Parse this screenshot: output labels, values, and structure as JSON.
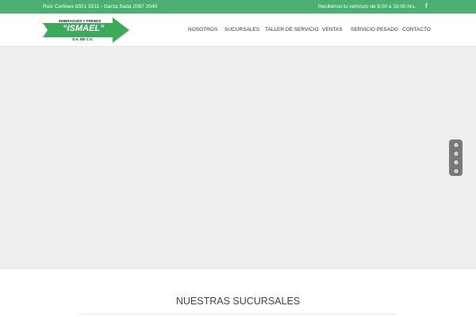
{
  "topbar": {
    "contact_text": "Ruiz Cortines 8351 5511 - Garza Sada 2087 2040",
    "hours_text": "Recibimos tu vehículo de 8:00 a 18:00 hrs.",
    "facebook_glyph": "f"
  },
  "logo": {
    "line1": "EMBRAGUES Y FRENOS",
    "line2": "“ISMAEL”",
    "line3": "S.A. DE C.V.",
    "arrow_color": "#3daa5b"
  },
  "nav": {
    "items": [
      "NOSOTROS",
      "SUCURSALES",
      "TALLER DE SERVICIO",
      "VENTAS",
      "SERVICIO PESADO",
      "CONTACTO"
    ]
  },
  "slider": {
    "dot_count": 4
  },
  "section": {
    "title": "NUESTRAS SUCURSALES"
  },
  "colors": {
    "topbar": "#4caf72",
    "slider_bg": "#efefef"
  }
}
